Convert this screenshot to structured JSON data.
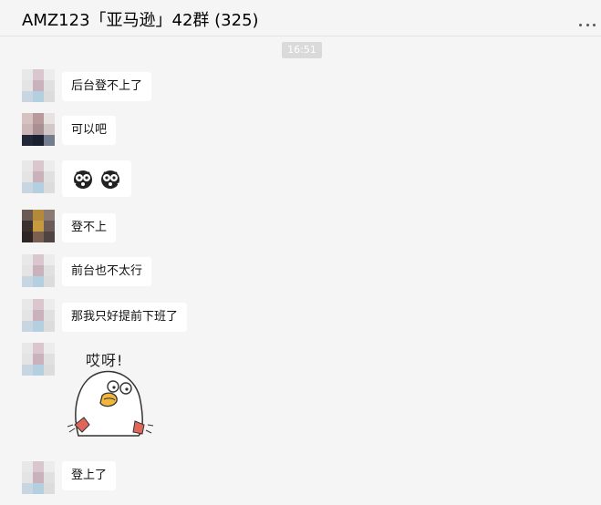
{
  "header": {
    "title": "AMZ123「亚马逊」42群 (325)",
    "more_icon": "more-dots-icon"
  },
  "time_badge": "16:51",
  "messages": [
    {
      "text": "后台登不上了",
      "avatar": "avatar-a"
    },
    {
      "text": "可以吧",
      "avatar": "avatar-b"
    },
    {
      "type": "emoji",
      "icons": [
        "dizzy-face-emoji",
        "dizzy-face-emoji"
      ],
      "avatar": "avatar-a"
    },
    {
      "text": "登不上",
      "avatar": "avatar-c"
    },
    {
      "text": "前台也不太行",
      "avatar": "avatar-a"
    },
    {
      "text": "那我只好提前下班了",
      "avatar": "avatar-a"
    },
    {
      "type": "sticker",
      "text": "哎呀!",
      "icon": "duck-sticker",
      "avatar": "avatar-a"
    },
    {
      "text": "登上了",
      "avatar": "avatar-a"
    }
  ],
  "colors": {
    "background": "#f5f5f5",
    "bubble": "#ffffff",
    "time_badge": "#dadada"
  }
}
